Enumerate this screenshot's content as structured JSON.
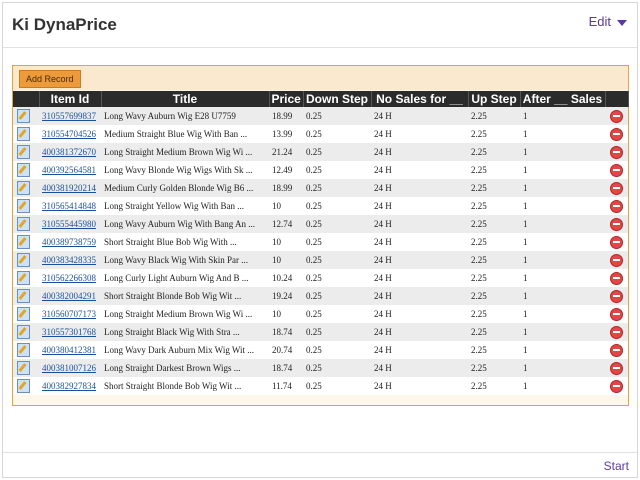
{
  "app": {
    "title": "Ki DynaPrice",
    "edit_label": "Edit",
    "start_label": "Start"
  },
  "toolbar": {
    "add_label": "Add Record"
  },
  "columns": [
    "Item Id",
    "Title",
    "Price",
    "Down Step",
    "No Sales for __",
    "Up Step",
    "After __ Sales"
  ],
  "rows": [
    {
      "id": "310557699837",
      "title": "Long Wavy Auburn Wig E28 U7759",
      "price": "18.99",
      "down": "0.25",
      "nosales": "24 H",
      "up": "2.25",
      "after": "1"
    },
    {
      "id": "310554704526",
      "title": "Medium Straight Blue Wig With Ban ...",
      "price": "13.99",
      "down": "0.25",
      "nosales": "24 H",
      "up": "2.25",
      "after": "1"
    },
    {
      "id": "400381372670",
      "title": "Long Straight Medium Brown Wig Wi ...",
      "price": "21.24",
      "down": "0.25",
      "nosales": "24 H",
      "up": "2.25",
      "after": "1"
    },
    {
      "id": "400392564581",
      "title": "Long Wavy Blonde Wig Wigs With Sk ...",
      "price": "12.49",
      "down": "0.25",
      "nosales": "24 H",
      "up": "2.25",
      "after": "1"
    },
    {
      "id": "400381920214",
      "title": "Medium Curly Golden Blonde Wig B6 ...",
      "price": "18.99",
      "down": "0.25",
      "nosales": "24 H",
      "up": "2.25",
      "after": "1"
    },
    {
      "id": "310565414848",
      "title": "Long Straight Yellow Wig With Ban ...",
      "price": "10",
      "down": "0.25",
      "nosales": "24 H",
      "up": "2.25",
      "after": "1"
    },
    {
      "id": "310555445980",
      "title": "Long Wavy Auburn Wig With Bang An ...",
      "price": "12.74",
      "down": "0.25",
      "nosales": "24 H",
      "up": "2.25",
      "after": "1"
    },
    {
      "id": "400389738759",
      "title": "Short Straight Blue Bob Wig With ...",
      "price": "10",
      "down": "0.25",
      "nosales": "24 H",
      "up": "2.25",
      "after": "1"
    },
    {
      "id": "400383428335",
      "title": "Long Wavy Black Wig With Skin Par ...",
      "price": "10",
      "down": "0.25",
      "nosales": "24 H",
      "up": "2.25",
      "after": "1"
    },
    {
      "id": "310562266308",
      "title": "Long Curly Light Auburn Wig And B ...",
      "price": "10.24",
      "down": "0.25",
      "nosales": "24 H",
      "up": "2.25",
      "after": "1"
    },
    {
      "id": "400382004291",
      "title": "Short Straight Blonde Bob Wig Wit ...",
      "price": "19.24",
      "down": "0.25",
      "nosales": "24 H",
      "up": "2.25",
      "after": "1"
    },
    {
      "id": "310560707173",
      "title": "Long Straight Medium Brown Wig Wi ...",
      "price": "10",
      "down": "0.25",
      "nosales": "24 H",
      "up": "2.25",
      "after": "1"
    },
    {
      "id": "310557301768",
      "title": "Long Straight Black Wig With Stra ...",
      "price": "18.74",
      "down": "0.25",
      "nosales": "24 H",
      "up": "2.25",
      "after": "1"
    },
    {
      "id": "400380412381",
      "title": "Long Wavy Dark Auburn Mix Wig Wit ...",
      "price": "20.74",
      "down": "0.25",
      "nosales": "24 H",
      "up": "2.25",
      "after": "1"
    },
    {
      "id": "400381007126",
      "title": "Long Straight Darkest Brown Wigs ...",
      "price": "18.74",
      "down": "0.25",
      "nosales": "24 H",
      "up": "2.25",
      "after": "1"
    },
    {
      "id": "400382927834",
      "title": "Short Straight Blonde Bob Wig Wit ...",
      "price": "11.74",
      "down": "0.25",
      "nosales": "24 H",
      "up": "2.25",
      "after": "1"
    }
  ]
}
